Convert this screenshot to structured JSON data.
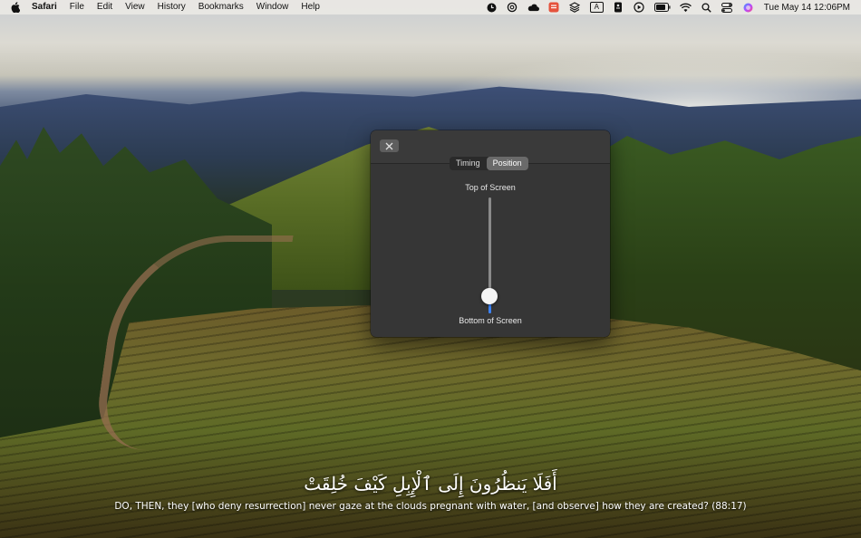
{
  "menubar": {
    "app_name": "Safari",
    "menus": [
      "File",
      "Edit",
      "View",
      "History",
      "Bookmarks",
      "Window",
      "Help"
    ],
    "status_icons": [
      "clock-icon",
      "openai-icon",
      "cloud-icon",
      "app-badge-icon",
      "layers-icon",
      "text-input-icon",
      "document-icon",
      "play-icon",
      "battery-icon",
      "wifi-icon",
      "search-icon",
      "control-center-icon",
      "siri-icon"
    ],
    "text_input_label": "A",
    "clock": "Tue May 14  12:06PM"
  },
  "panel": {
    "tabs": [
      {
        "label": "Timing",
        "active": false
      },
      {
        "label": "Position",
        "active": true
      }
    ],
    "top_label": "Top of Screen",
    "bottom_label": "Bottom of Screen",
    "slider_value": 0.15,
    "accent_color": "#3b82f6"
  },
  "verse": {
    "arabic": "أَفَلَا يَنظُرُونَ إِلَى ٱلْإِبِلِ كَيْفَ خُلِقَتْ",
    "translation": "DO, THEN, they [who deny resurrection] never gaze at the clouds pregnant with water, [and observe] how they are created? (88:17)"
  }
}
